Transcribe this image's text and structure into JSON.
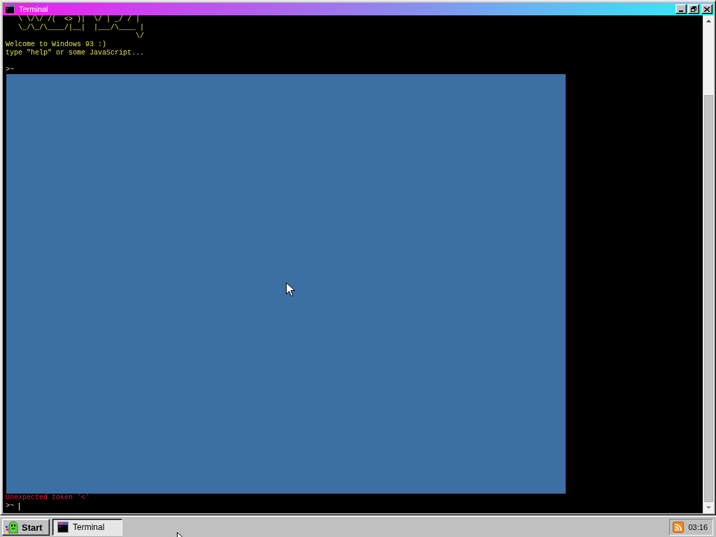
{
  "window": {
    "title": "Terminal"
  },
  "terminal": {
    "lines": [
      {
        "kind": "art",
        "text": "   \\ \\/\\/ /(  <> )|  \\/ | _/ / |\n   \\_/\\_/\\____/|__|  |___/\\____ |\n                               \\/"
      },
      {
        "kind": "message",
        "text": "Welcome to Windows 93 :)"
      },
      {
        "kind": "message",
        "text": "type \"help\" or some JavaScript..."
      },
      {
        "kind": "blank"
      },
      {
        "kind": "prompt",
        "text": ">~"
      },
      {
        "kind": "frame"
      },
      {
        "kind": "error",
        "text": "Unexpected token '<'"
      },
      {
        "kind": "input",
        "text": ">~"
      }
    ]
  },
  "taskbar": {
    "start": "Start",
    "tasks": [
      {
        "label": "Terminal",
        "selected": true
      }
    ],
    "clock": "03:16"
  }
}
